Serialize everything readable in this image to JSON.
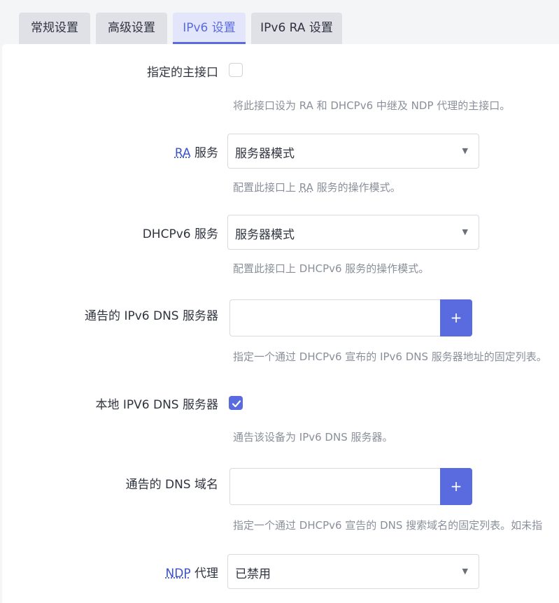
{
  "tabs": [
    {
      "label": "常规设置"
    },
    {
      "label": "高级设置"
    },
    {
      "label": "IPv6 设置"
    },
    {
      "label": "IPv6 RA 设置"
    }
  ],
  "fields": {
    "master": {
      "label": "指定的主接口",
      "checked": false,
      "description": "将此接口设为 RA 和 DHCPv6 中继及 NDP 代理的主接口。"
    },
    "ra_service": {
      "label_abbr": "RA",
      "label_rest": " 服务",
      "value": "服务器模式",
      "desc_pre": "配置此接口上 ",
      "desc_abbr": "RA",
      "desc_post": " 服务的操作模式。"
    },
    "dhcpv6_service": {
      "label": "DHCPv6 服务",
      "value": "服务器模式",
      "description": "配置此接口上 DHCPv6 服务的操作模式。"
    },
    "ipv6_dns": {
      "label": "通告的 IPv6 DNS 服务器",
      "value": "",
      "button": "+",
      "description": "指定一个通过 DHCPv6 宣布的 IPv6 DNS 服务器地址的固定列表。"
    },
    "local_ipv6_dns": {
      "label": "本地 IPV6 DNS 服务器",
      "checked": true,
      "description": "通告该设备为 IPv6 DNS 服务器。"
    },
    "dns_domain": {
      "label": "通告的 DNS 域名",
      "value": "",
      "button": "+",
      "description": "指定一个通过 DHCPv6 宣告的 DNS 搜索域名的固定列表。如未指"
    },
    "ndp_proxy": {
      "label_abbr": "NDP",
      "label_rest": " 代理",
      "value": "已禁用"
    }
  },
  "colors": {
    "accent": "#5a6be0",
    "tab_inactive": "#dfe1e6",
    "description": "#8a8f9a"
  }
}
